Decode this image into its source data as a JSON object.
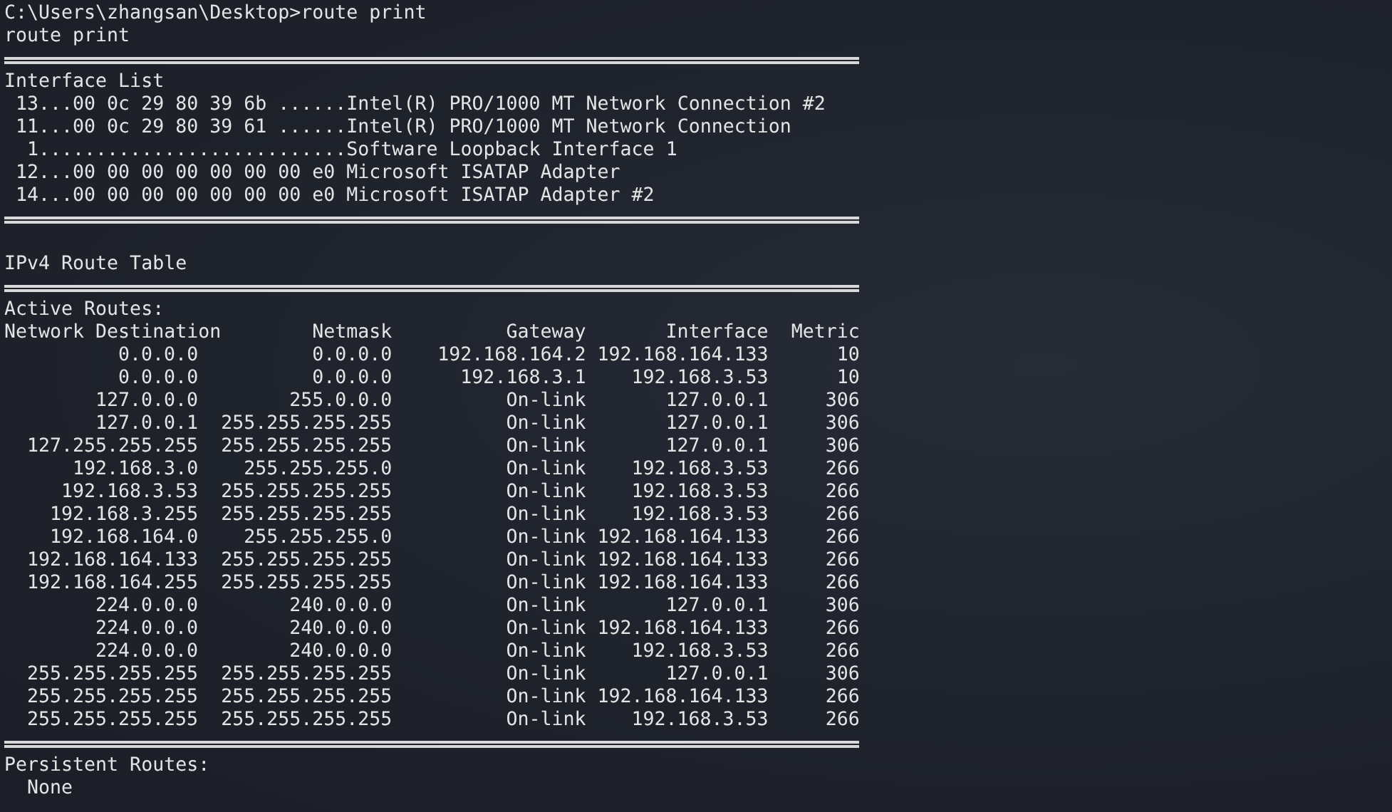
{
  "prompt": "C:\\Users\\zhangsan\\Desktop>route print",
  "echo": "route print",
  "interface_list": {
    "title": "Interface List",
    "entries": [
      {
        "id": "13",
        "text": "...00 0c 29 80 39 6b ......Intel(R) PRO/1000 MT Network Connection #2"
      },
      {
        "id": "11",
        "text": "...00 0c 29 80 39 61 ......Intel(R) PRO/1000 MT Network Connection"
      },
      {
        "id": "1",
        "text": "...........................Software Loopback Interface 1"
      },
      {
        "id": "12",
        "text": "...00 00 00 00 00 00 00 e0 Microsoft ISATAP Adapter"
      },
      {
        "id": "14",
        "text": "...00 00 00 00 00 00 00 e0 Microsoft ISATAP Adapter #2"
      }
    ]
  },
  "ipv4_route_table": {
    "title": "IPv4 Route Table",
    "active_routes": {
      "title": "Active Routes:",
      "columns": [
        "Network Destination",
        "Netmask",
        "Gateway",
        "Interface",
        "Metric"
      ],
      "rows": [
        [
          "0.0.0.0",
          "0.0.0.0",
          "192.168.164.2",
          "192.168.164.133",
          "10"
        ],
        [
          "0.0.0.0",
          "0.0.0.0",
          "192.168.3.1",
          "192.168.3.53",
          "10"
        ],
        [
          "127.0.0.0",
          "255.0.0.0",
          "On-link",
          "127.0.0.1",
          "306"
        ],
        [
          "127.0.0.1",
          "255.255.255.255",
          "On-link",
          "127.0.0.1",
          "306"
        ],
        [
          "127.255.255.255",
          "255.255.255.255",
          "On-link",
          "127.0.0.1",
          "306"
        ],
        [
          "192.168.3.0",
          "255.255.255.0",
          "On-link",
          "192.168.3.53",
          "266"
        ],
        [
          "192.168.3.53",
          "255.255.255.255",
          "On-link",
          "192.168.3.53",
          "266"
        ],
        [
          "192.168.3.255",
          "255.255.255.255",
          "On-link",
          "192.168.3.53",
          "266"
        ],
        [
          "192.168.164.0",
          "255.255.255.0",
          "On-link",
          "192.168.164.133",
          "266"
        ],
        [
          "192.168.164.133",
          "255.255.255.255",
          "On-link",
          "192.168.164.133",
          "266"
        ],
        [
          "192.168.164.255",
          "255.255.255.255",
          "On-link",
          "192.168.164.133",
          "266"
        ],
        [
          "224.0.0.0",
          "240.0.0.0",
          "On-link",
          "127.0.0.1",
          "306"
        ],
        [
          "224.0.0.0",
          "240.0.0.0",
          "On-link",
          "192.168.164.133",
          "266"
        ],
        [
          "224.0.0.0",
          "240.0.0.0",
          "On-link",
          "192.168.3.53",
          "266"
        ],
        [
          "255.255.255.255",
          "255.255.255.255",
          "On-link",
          "127.0.0.1",
          "306"
        ],
        [
          "255.255.255.255",
          "255.255.255.255",
          "On-link",
          "192.168.164.133",
          "266"
        ],
        [
          "255.255.255.255",
          "255.255.255.255",
          "On-link",
          "192.168.3.53",
          "266"
        ]
      ]
    }
  },
  "persistent_routes": {
    "title": "Persistent Routes:",
    "value": "None"
  }
}
